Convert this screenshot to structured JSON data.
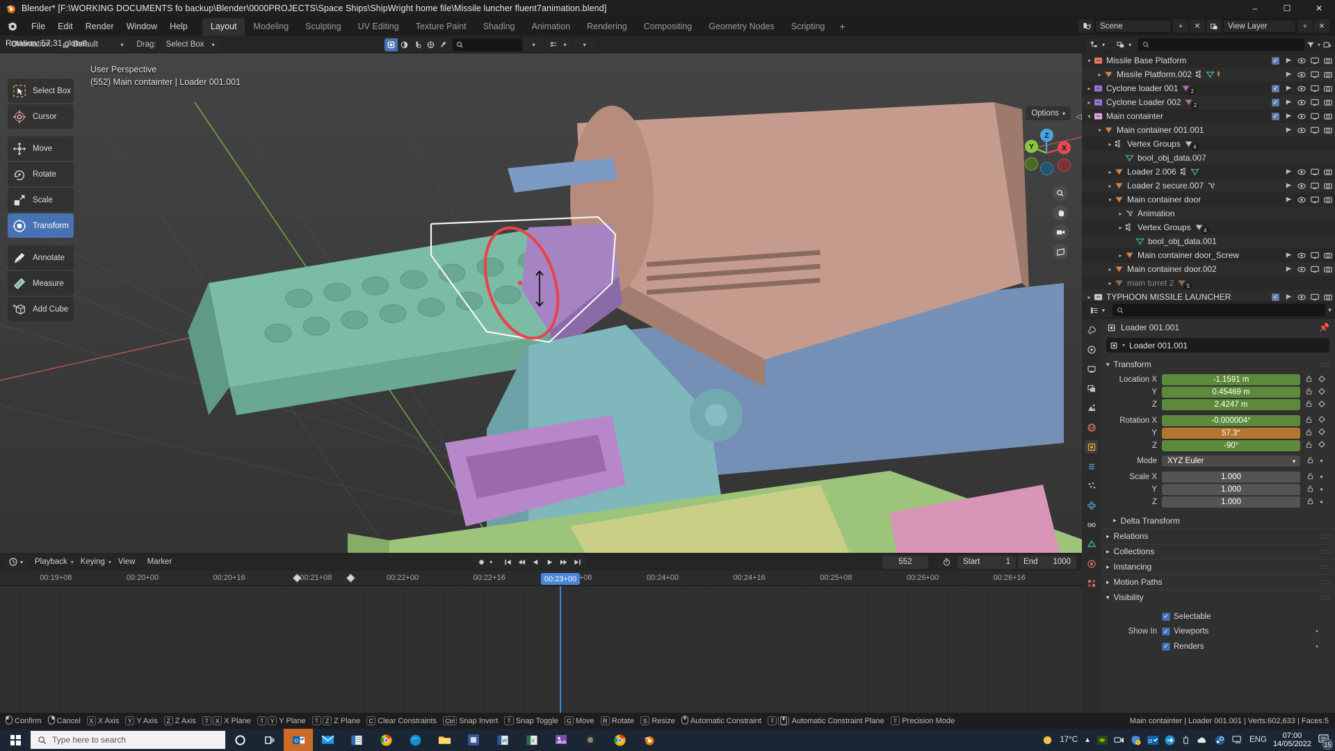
{
  "window": {
    "title": "Blender* [F:\\WORKING DOCUMENTS fo backup\\Blender\\0000PROJECTS\\Space Ships\\ShipWright home file\\Missile luncher fluent7animation.blend]",
    "minimize": "–",
    "maximize": "☐",
    "close": "✕"
  },
  "topbar": {
    "menus": [
      "File",
      "Edit",
      "Render",
      "Window",
      "Help"
    ],
    "workspaces": [
      "Layout",
      "Modeling",
      "Sculpting",
      "UV Editing",
      "Texture Paint",
      "Shading",
      "Animation",
      "Rendering",
      "Compositing",
      "Geometry Nodes",
      "Scripting"
    ],
    "active_workspace": "Layout",
    "add_workspace": "+",
    "scene_name": "Scene",
    "view_layer_name": "View Layer"
  },
  "statusline": {
    "operator": "Rotation: 57.31 global"
  },
  "viewport": {
    "header": {
      "mode_label": "Orientation:",
      "orientation_value": "Default",
      "drag_label": "Drag:",
      "drag_value": "Select Box",
      "search_placeholder": "",
      "options_label": "Options"
    },
    "info_line1": "User Perspective",
    "info_line2": "(552) Main containter | Loader 001.001",
    "gizmo_axes": [
      "X",
      "Y",
      "Z"
    ],
    "tools": [
      {
        "label": "Select Box",
        "icon": "select-box-icon",
        "selected": false
      },
      {
        "label": "Cursor",
        "icon": "cursor-icon",
        "selected": false
      },
      {
        "label": "Move",
        "icon": "move-icon",
        "selected": false
      },
      {
        "label": "Rotate",
        "icon": "rotate-icon",
        "selected": false
      },
      {
        "label": "Scale",
        "icon": "scale-icon",
        "selected": false
      },
      {
        "label": "Transform",
        "icon": "transform-icon",
        "selected": true
      },
      {
        "label": "Annotate",
        "icon": "annotate-icon",
        "selected": false
      },
      {
        "label": "Measure",
        "icon": "measure-icon",
        "selected": false
      },
      {
        "label": "Add Cube",
        "icon": "add-cube-icon",
        "selected": false
      }
    ]
  },
  "timeline": {
    "menus": [
      "Playback",
      "Keying",
      "View",
      "Marker"
    ],
    "current_frame": "552",
    "start_label": "Start",
    "start_value": "1",
    "end_label": "End",
    "end_value": "1000",
    "playhead_label": "00:23+00",
    "ticks": [
      "00:19+08",
      "00:20+00",
      "00:20+16",
      "00:21+08",
      "00:22+00",
      "00:22+16",
      "00:23+08",
      "00:24+00",
      "00:24+16",
      "00:25+08",
      "00:26+00",
      "00:26+16"
    ],
    "keyframes": [
      426,
      503
    ]
  },
  "outliner": {
    "search_placeholder": "",
    "rows": [
      {
        "label": "Missile Base Platform",
        "indent": 0,
        "icon": "collection-icon",
        "color": "#e07a6a",
        "disclosure": "down",
        "checkbox": true,
        "icons": [
          "arrow",
          "eye",
          "screen",
          "camera"
        ]
      },
      {
        "label": "Missile Platform.002",
        "indent": 1,
        "icon": "mesh-icon",
        "color": "#d38a52",
        "disclosure": "right",
        "checkbox": false,
        "extra": [
          "vertexgroup",
          "meshdata",
          "mod"
        ],
        "icons": [
          "arrow",
          "eye",
          "screen",
          "camera"
        ]
      },
      {
        "label": "Cyclone loader 001",
        "indent": 0,
        "icon": "collection-icon",
        "color": "#9a74d6",
        "disclosure": "right",
        "checkbox": true,
        "badge": "2",
        "icons": [
          "arrow",
          "eye",
          "screen",
          "camera"
        ]
      },
      {
        "label": "Cyclone Loader 002",
        "indent": 0,
        "icon": "collection-icon",
        "color": "#9a74d6",
        "disclosure": "right",
        "checkbox": true,
        "badge": "2",
        "icons": [
          "arrow",
          "eye",
          "screen",
          "camera"
        ]
      },
      {
        "label": "Main containter",
        "indent": 0,
        "icon": "collection-icon",
        "color": "#e0a8e0",
        "disclosure": "down",
        "checkbox": true,
        "icons": [
          "arrow",
          "eye",
          "screen",
          "camera"
        ]
      },
      {
        "label": "Main container 001.001",
        "indent": 1,
        "icon": "mesh-icon",
        "color": "#d38a52",
        "disclosure": "down",
        "checkbox": false,
        "icons": [
          "arrow",
          "eye",
          "screen",
          "camera"
        ]
      },
      {
        "label": "Vertex Groups",
        "indent": 2,
        "icon": "vertexgroup-icon",
        "color": "#c8c8c8",
        "disclosure": "right",
        "checkbox": false,
        "badge": "4",
        "icons": []
      },
      {
        "label": "bool_obj_data.007",
        "indent": 3,
        "icon": "meshdata-icon",
        "color": "#3fbf8f",
        "disclosure": "none",
        "checkbox": false,
        "icons": []
      },
      {
        "label": "Loader 2.006",
        "indent": 2,
        "icon": "mesh-icon",
        "color": "#d38a52",
        "disclosure": "right",
        "checkbox": false,
        "extra": [
          "vertexgroup",
          "meshdata"
        ],
        "icons": [
          "arrow",
          "eye",
          "screen",
          "camera"
        ]
      },
      {
        "label": "Loader 2 secure.007",
        "indent": 2,
        "icon": "mesh-icon",
        "color": "#d38a52",
        "disclosure": "right",
        "checkbox": false,
        "extra": [
          "anim"
        ],
        "icons": [
          "arrow",
          "eye",
          "screen",
          "camera"
        ]
      },
      {
        "label": "Main container door",
        "indent": 2,
        "icon": "mesh-icon",
        "color": "#d38a52",
        "disclosure": "down",
        "checkbox": false,
        "icons": [
          "arrow",
          "eye",
          "screen",
          "camera"
        ]
      },
      {
        "label": "Animation",
        "indent": 3,
        "icon": "animation-icon",
        "color": "#c8c8c8",
        "disclosure": "right",
        "checkbox": false,
        "icons": []
      },
      {
        "label": "Vertex Groups",
        "indent": 3,
        "icon": "vertexgroup-icon",
        "color": "#c8c8c8",
        "disclosure": "right",
        "checkbox": false,
        "badge": "4",
        "icons": []
      },
      {
        "label": "bool_obj_data.001",
        "indent": 4,
        "icon": "meshdata-icon",
        "color": "#3fbf8f",
        "disclosure": "none",
        "checkbox": false,
        "icons": []
      },
      {
        "label": "Main container door_Screw",
        "indent": 3,
        "icon": "mesh-icon",
        "color": "#d38a52",
        "disclosure": "right",
        "checkbox": false,
        "icons": [
          "arrow",
          "eye",
          "screen",
          "camera"
        ]
      },
      {
        "label": "Main container door.002",
        "indent": 2,
        "icon": "mesh-icon",
        "color": "#d38a52",
        "disclosure": "right",
        "checkbox": false,
        "icons": [
          "arrow",
          "eye",
          "screen",
          "camera"
        ]
      },
      {
        "label": "main turret 2",
        "indent": 2,
        "icon": "mesh-icon",
        "color": "#8a7055",
        "disclosure": "right",
        "checkbox": false,
        "badge": "5",
        "dim": true,
        "icons": []
      },
      {
        "label": "TYPHOON MISSILE LAUNCHER",
        "indent": 0,
        "icon": "collection-icon",
        "color": "#c8c8c8",
        "disclosure": "right",
        "checkbox": true,
        "icons": [
          "arrow",
          "eye",
          "screen",
          "camera"
        ]
      }
    ]
  },
  "properties": {
    "search_placeholder": "",
    "breadcrumb": "Loader 001.001",
    "object_name": "Loader 001.001",
    "sections": {
      "transform": "Transform",
      "delta_transform": "Delta Transform",
      "relations": "Relations",
      "collections": "Collections",
      "instancing": "Instancing",
      "motion_paths": "Motion Paths",
      "visibility": "Visibility"
    },
    "transform_rows": [
      {
        "label": "Location X",
        "value": "-1.1591 m",
        "color": "green"
      },
      {
        "label": "Y",
        "value": "0.45469 m",
        "color": "green"
      },
      {
        "label": "Z",
        "value": "2.4247 m",
        "color": "green"
      },
      {
        "label": "Rotation X",
        "value": "-0.000004°",
        "color": "green"
      },
      {
        "label": "Y",
        "value": "57.3°",
        "color": "orange"
      },
      {
        "label": "Z",
        "value": "-90°",
        "color": "green"
      },
      {
        "label": "Mode",
        "value": "XYZ Euler",
        "color": "drop"
      },
      {
        "label": "Scale X",
        "value": "1.000",
        "color": "grey"
      },
      {
        "label": "Y",
        "value": "1.000",
        "color": "grey"
      },
      {
        "label": "Z",
        "value": "1.000",
        "color": "grey"
      }
    ],
    "visibility": {
      "selectable_label": "Selectable",
      "show_in_label": "Show In",
      "viewports_label": "Viewports",
      "renders_label": "Renders"
    }
  },
  "statusbar": {
    "keys": [
      {
        "key": "LMB",
        "label": "Confirm"
      },
      {
        "key": "RMB",
        "label": "Cancel"
      },
      {
        "key": "X",
        "label": "X Axis"
      },
      {
        "key": "Y",
        "label": "Y Axis"
      },
      {
        "key": "Z",
        "label": "Z Axis"
      },
      {
        "key": "⇧X",
        "label": "X Plane"
      },
      {
        "key": "⇧Y",
        "label": "Y Plane"
      },
      {
        "key": "⇧Z",
        "label": "Z Plane"
      },
      {
        "key": "C",
        "label": "Clear Constraints"
      },
      {
        "key": "Ctrl",
        "label": "Snap Invert"
      },
      {
        "key": "⇧",
        "label": "Snap Toggle"
      },
      {
        "key": "G",
        "label": "Move"
      },
      {
        "key": "R",
        "label": "Rotate"
      },
      {
        "key": "S",
        "label": "Resize"
      },
      {
        "key": "MMB",
        "label": "Automatic Constraint"
      },
      {
        "key": "⇧MMB",
        "label": "Automatic Constraint Plane"
      },
      {
        "key": "⇧",
        "label": "Precision Mode"
      }
    ],
    "stats": "Main containter | Loader 001.001 | Verts:602,633 | Faces:5"
  },
  "taskbar": {
    "search_placeholder": "Type here to search",
    "temperature": "17°C",
    "language": "ENG",
    "time": "07:00",
    "date": "14/05/2022",
    "notification_count": "15"
  }
}
